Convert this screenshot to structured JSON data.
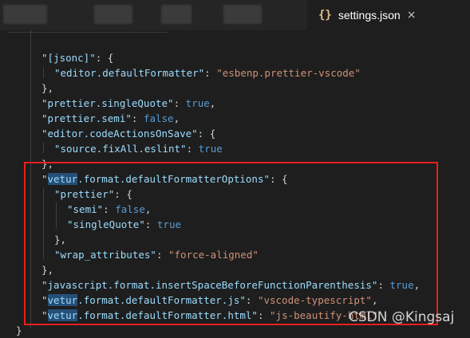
{
  "tab": {
    "icon": "{}",
    "title": "settings.json",
    "close": "×"
  },
  "code": [
    {
      "p": [
        {
          "t": "\"[jsonc]\"",
          "c": "key"
        },
        {
          "t": ": {",
          "c": "pun"
        }
      ]
    },
    {
      "p": [
        {
          "t": "\"editor.defaultFormatter\"",
          "c": "key"
        },
        {
          "t": ": ",
          "c": "pun"
        },
        {
          "t": "\"esbenp.prettier-vscode\"",
          "c": "str"
        }
      ]
    },
    {
      "p": [
        {
          "t": "},",
          "c": "pun"
        }
      ]
    },
    {
      "p": [
        {
          "t": "\"prettier.singleQuote\"",
          "c": "key"
        },
        {
          "t": ": ",
          "c": "pun"
        },
        {
          "t": "true",
          "c": "kw"
        },
        {
          "t": ",",
          "c": "pun"
        }
      ]
    },
    {
      "p": [
        {
          "t": "\"prettier.semi\"",
          "c": "key"
        },
        {
          "t": ": ",
          "c": "pun"
        },
        {
          "t": "false",
          "c": "kw"
        },
        {
          "t": ",",
          "c": "pun"
        }
      ]
    },
    {
      "p": [
        {
          "t": "\"editor.codeActionsOnSave\"",
          "c": "key"
        },
        {
          "t": ": {",
          "c": "pun"
        }
      ]
    },
    {
      "p": [
        {
          "t": "\"source.fixAll.eslint\"",
          "c": "key"
        },
        {
          "t": ": ",
          "c": "pun"
        },
        {
          "t": "true",
          "c": "kw"
        }
      ]
    },
    {
      "p": [
        {
          "t": "},",
          "c": "pun"
        }
      ]
    },
    {
      "p": [
        {
          "t": "\"",
          "c": "key"
        },
        {
          "t": "vetur",
          "c": "key sel"
        },
        {
          "t": ".format.defaultFormatterOptions\"",
          "c": "key"
        },
        {
          "t": ": {",
          "c": "pun"
        }
      ]
    },
    {
      "p": [
        {
          "t": "\"prettier\"",
          "c": "key"
        },
        {
          "t": ": {",
          "c": "pun"
        }
      ]
    },
    {
      "p": [
        {
          "t": "\"semi\"",
          "c": "key"
        },
        {
          "t": ": ",
          "c": "pun"
        },
        {
          "t": "false",
          "c": "kw"
        },
        {
          "t": ",",
          "c": "pun"
        }
      ]
    },
    {
      "p": [
        {
          "t": "\"singleQuote\"",
          "c": "key"
        },
        {
          "t": ": ",
          "c": "pun"
        },
        {
          "t": "true",
          "c": "kw"
        }
      ]
    },
    {
      "p": [
        {
          "t": "},",
          "c": "pun"
        }
      ]
    },
    {
      "p": [
        {
          "t": "\"wrap_attributes\"",
          "c": "key"
        },
        {
          "t": ": ",
          "c": "pun"
        },
        {
          "t": "\"force-aligned\"",
          "c": "str"
        }
      ]
    },
    {
      "p": [
        {
          "t": "},",
          "c": "pun"
        }
      ]
    },
    {
      "p": [
        {
          "t": "\"javascript.format.insertSpaceBeforeFunctionParenthesis\"",
          "c": "key"
        },
        {
          "t": ": ",
          "c": "pun"
        },
        {
          "t": "true",
          "c": "kw"
        },
        {
          "t": ",",
          "c": "pun"
        }
      ]
    },
    {
      "p": [
        {
          "t": "\"",
          "c": "key"
        },
        {
          "t": "vetur",
          "c": "key sel"
        },
        {
          "t": ".format.defaultFormatter.js\"",
          "c": "key"
        },
        {
          "t": ": ",
          "c": "pun"
        },
        {
          "t": "\"vscode-typescript\"",
          "c": "str"
        },
        {
          "t": ",",
          "c": "pun"
        }
      ]
    },
    {
      "p": [
        {
          "t": "\"",
          "c": "key"
        },
        {
          "t": "vetur",
          "c": "key sel"
        },
        {
          "t": ".format.defaultFormatter.html\"",
          "c": "key"
        },
        {
          "t": ": ",
          "c": "pun"
        },
        {
          "t": "\"js-beautify-html\"",
          "c": "str"
        }
      ]
    },
    {
      "p": [
        {
          "t": "}",
          "c": "pun"
        }
      ]
    }
  ],
  "watermark": "CSDN @Kingsaj",
  "colors": {
    "key": "#9cdcfe",
    "string": "#ce9178",
    "keyword": "#569cd6",
    "highlight_box": "#e81f1f"
  }
}
